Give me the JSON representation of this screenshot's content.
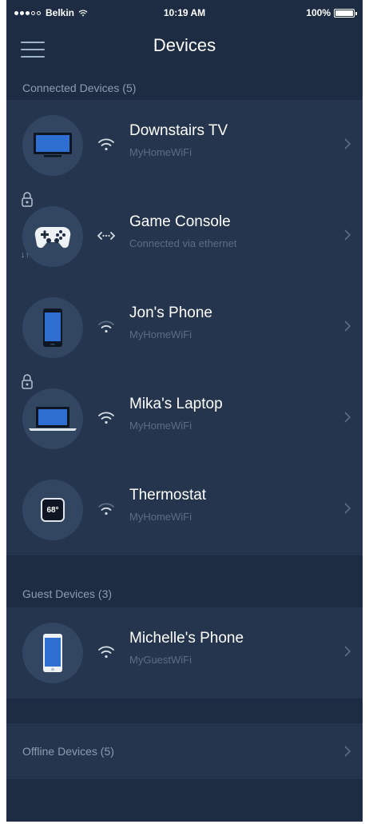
{
  "status_bar": {
    "carrier": "Belkin",
    "time": "10:19 AM",
    "battery": "100%",
    "battery_level": 1.0
  },
  "nav": {
    "title": "Devices",
    "menu_icon": "hamburger-menu-icon"
  },
  "connected": {
    "header": "Connected Devices (5)",
    "devices": [
      {
        "name": "Downstairs TV",
        "network": "MyHomeWiFi",
        "icon": "tv-icon",
        "connection": "wifi-icon"
      },
      {
        "name": "Game Console",
        "network": "Connected via ethernet",
        "icon": "gamepad-icon",
        "connection": "ethernet-icon",
        "locked": true,
        "priority": true
      },
      {
        "name": "Jon's Phone",
        "network": "MyHomeWiFi",
        "icon": "smartphone-icon",
        "connection": "wifi-icon"
      },
      {
        "name": "Mika's Laptop",
        "network": "MyHomeWiFi",
        "icon": "laptop-icon",
        "connection": "wifi-icon",
        "locked": true
      },
      {
        "name": "Thermostat",
        "network": "MyHomeWiFi",
        "icon": "thermostat-icon",
        "connection": "wifi-icon",
        "temperature": "68°"
      }
    ]
  },
  "guest": {
    "header": "Guest Devices (3)",
    "devices": [
      {
        "name": "Michelle's Phone",
        "network": "MyGuestWiFi",
        "icon": "smartphone-icon",
        "connection": "wifi-icon"
      }
    ]
  },
  "offline": {
    "label": "Offline Devices (5)"
  },
  "colors": {
    "background": "#1d2c42",
    "card": "#24354d",
    "avatar": "#324662",
    "secondary_text": "#8d9db1",
    "subtitle_text": "#5b6e86",
    "icon_blue": "#2e6fd1"
  }
}
